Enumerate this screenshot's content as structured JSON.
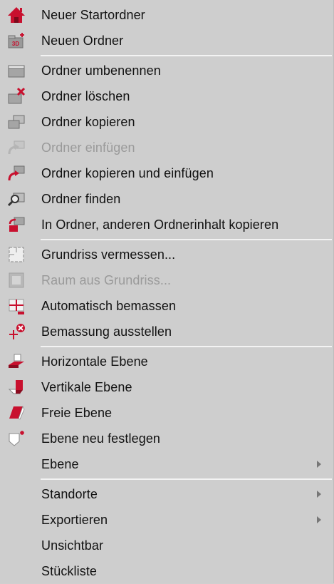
{
  "colors": {
    "accent": "#c8102e",
    "text": "#111111",
    "disabled_text": "#9a9a9a",
    "menu_bg": "#cecece",
    "separator": "#f3f3f3"
  },
  "menu": {
    "items": [
      {
        "label": "Neuer Startordner",
        "icon": "home-icon",
        "enabled": true,
        "submenu": false
      },
      {
        "label": "Neuen Ordner",
        "icon": "new-folder-3d-icon",
        "icon_text": "3D",
        "enabled": true,
        "submenu": false
      },
      {
        "label": "Ordner umbenennen",
        "icon": "rename-folder-icon",
        "enabled": true,
        "submenu": false
      },
      {
        "label": "Ordner löschen",
        "icon": "delete-folder-icon",
        "enabled": true,
        "submenu": false
      },
      {
        "label": "Ordner kopieren",
        "icon": "copy-folder-icon",
        "enabled": true,
        "submenu": false
      },
      {
        "label": "Ordner einfügen",
        "icon": "paste-folder-icon",
        "enabled": false,
        "submenu": false
      },
      {
        "label": "Ordner kopieren und einfügen",
        "icon": "copy-paste-folder-icon",
        "enabled": true,
        "submenu": false
      },
      {
        "label": "Ordner finden",
        "icon": "find-folder-icon",
        "enabled": true,
        "submenu": false
      },
      {
        "label": "In Ordner, anderen Ordnerinhalt kopieren",
        "icon": "copy-content-into-folder-icon",
        "enabled": true,
        "submenu": false
      },
      {
        "label": "Grundriss vermessen...",
        "icon": "measure-floorplan-icon",
        "enabled": true,
        "submenu": false
      },
      {
        "label": "Raum aus Grundriss...",
        "icon": "room-from-floorplan-icon",
        "enabled": false,
        "submenu": false
      },
      {
        "label": "Automatisch bemassen",
        "icon": "auto-dimension-icon",
        "enabled": true,
        "submenu": false
      },
      {
        "label": "Bemassung ausstellen",
        "icon": "dimension-off-icon",
        "enabled": true,
        "submenu": false
      },
      {
        "label": "Horizontale Ebene",
        "icon": "horizontal-plane-icon",
        "enabled": true,
        "submenu": false
      },
      {
        "label": "Vertikale Ebene",
        "icon": "vertical-plane-icon",
        "enabled": true,
        "submenu": false
      },
      {
        "label": "Freie Ebene",
        "icon": "free-plane-icon",
        "enabled": true,
        "submenu": false
      },
      {
        "label": "Ebene neu festlegen",
        "icon": "redefine-plane-icon",
        "enabled": true,
        "submenu": false
      },
      {
        "label": "Ebene",
        "icon": "",
        "enabled": true,
        "submenu": true
      },
      {
        "label": "Standorte",
        "icon": "",
        "enabled": true,
        "submenu": true
      },
      {
        "label": "Exportieren",
        "icon": "",
        "enabled": true,
        "submenu": true
      },
      {
        "label": "Unsichtbar",
        "icon": "",
        "enabled": true,
        "submenu": false
      },
      {
        "label": "Stückliste",
        "icon": "",
        "enabled": true,
        "submenu": false
      }
    ]
  }
}
